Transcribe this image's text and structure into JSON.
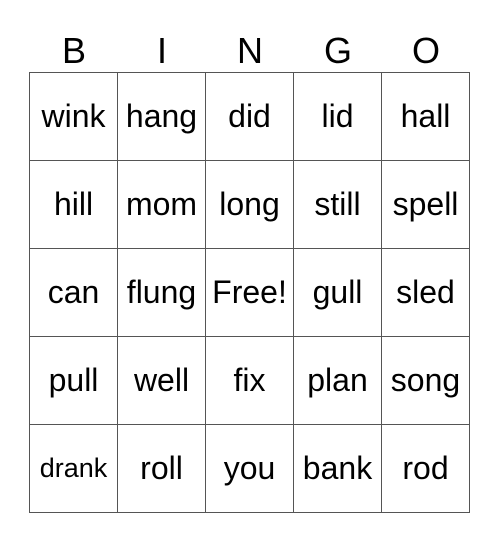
{
  "header": [
    "B",
    "I",
    "N",
    "G",
    "O"
  ],
  "rows": [
    [
      "wink",
      "hang",
      "did",
      "lid",
      "hall"
    ],
    [
      "hill",
      "mom",
      "long",
      "still",
      "spell"
    ],
    [
      "can",
      "flung",
      "Free!",
      "gull",
      "sled"
    ],
    [
      "pull",
      "well",
      "fix",
      "plan",
      "song"
    ],
    [
      "drank",
      "roll",
      "you",
      "bank",
      "rod"
    ]
  ]
}
